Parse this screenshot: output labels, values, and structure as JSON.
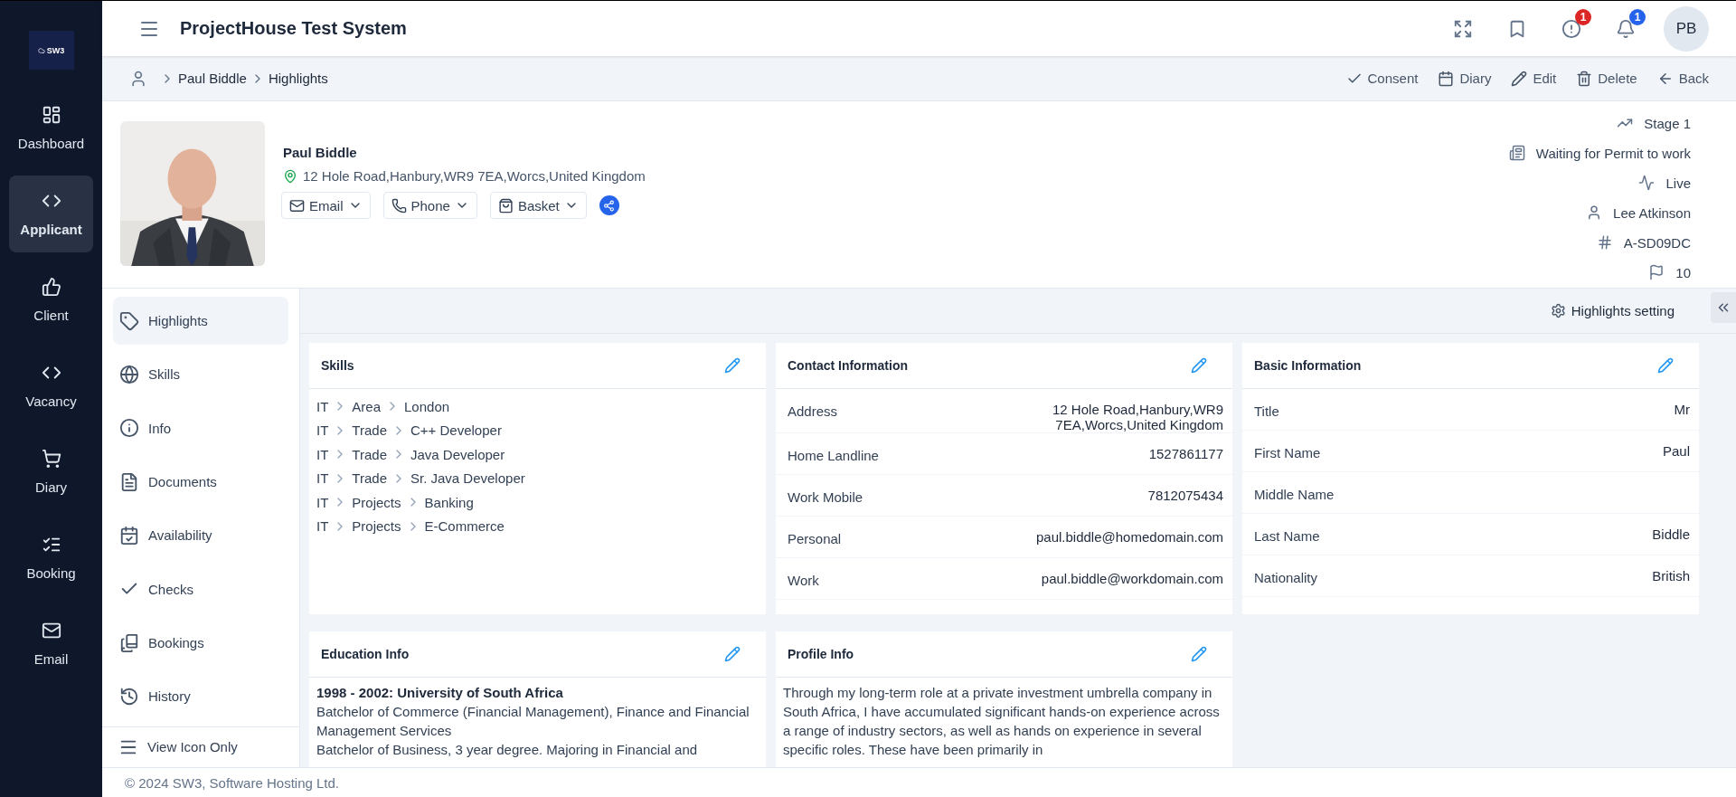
{
  "app": {
    "logo": "SW3",
    "title": "ProjectHouse Test System",
    "avatar": "PB"
  },
  "header_icons": [
    {
      "kind": "fullscreen"
    },
    {
      "kind": "bookmark"
    },
    {
      "kind": "alert",
      "badge": "1",
      "color": "#dc2626"
    },
    {
      "kind": "notifications",
      "badge": "1",
      "color": "#2563eb"
    }
  ],
  "nav": [
    {
      "label": "Dashboard",
      "selected": false
    },
    {
      "label": "Applicant",
      "selected": true
    },
    {
      "label": "Client",
      "selected": false
    },
    {
      "label": "Vacancy",
      "selected": false
    },
    {
      "label": "Diary",
      "selected": false
    },
    {
      "label": "Booking",
      "selected": false
    },
    {
      "label": "Email",
      "selected": false
    }
  ],
  "breadcrumb": [
    "Paul Biddle",
    "Highlights"
  ],
  "actions": [
    "Consent",
    "Diary",
    "Edit",
    "Delete",
    "Back"
  ],
  "profile": {
    "name": "Paul Biddle",
    "address": "12 Hole Road,Hanbury,WR9 7EA,Worcs,United Kingdom",
    "buttons": [
      "Email",
      "Phone",
      "Basket"
    ],
    "status": [
      "Stage 1",
      "Waiting for Permit to work",
      "Live",
      "Lee Atkinson",
      "A-SD09DC",
      "10"
    ]
  },
  "subnav": {
    "items": [
      {
        "label": "Highlights",
        "selected": true
      },
      {
        "label": "Skills",
        "selected": false
      },
      {
        "label": "Info",
        "selected": false
      },
      {
        "label": "Documents",
        "selected": false
      },
      {
        "label": "Availability",
        "selected": false
      },
      {
        "label": "Checks",
        "selected": false
      },
      {
        "label": "Bookings",
        "selected": false
      },
      {
        "label": "History",
        "selected": false
      }
    ],
    "toggle": "View Icon Only"
  },
  "settings_button": "Highlights setting",
  "cards": [
    {
      "kind": "paths",
      "title": "Skills",
      "paths": [
        [
          "IT",
          "Area",
          "London"
        ],
        [
          "IT",
          "Trade",
          "C++ Developer"
        ],
        [
          "IT",
          "Trade",
          "Java Developer"
        ],
        [
          "IT",
          "Trade",
          "Sr. Java Developer"
        ],
        [
          "IT",
          "Projects",
          "Banking"
        ],
        [
          "IT",
          "Projects",
          "E-Commerce"
        ]
      ]
    },
    {
      "kind": "fields",
      "title": "Contact Information",
      "rows": [
        {
          "label": "Address",
          "value": "12 Hole Road,Hanbury,WR9 7EA,Worcs,United Kingdom"
        },
        {
          "label": "Home Landline",
          "value": "1527861177"
        },
        {
          "label": "Work Mobile",
          "value": "7812075434"
        },
        {
          "label": "Personal",
          "value": "paul.biddle@homedomain.com"
        },
        {
          "label": "Work",
          "value": "paul.biddle@workdomain.com"
        }
      ]
    },
    {
      "kind": "fields",
      "title": "Basic Information",
      "rows": [
        {
          "label": "Title",
          "value": "Mr"
        },
        {
          "label": "First Name",
          "value": "Paul"
        },
        {
          "label": "Middle Name"
        },
        {
          "label": "Last Name",
          "value": "Biddle"
        },
        {
          "label": "Nationality",
          "value": "British"
        }
      ]
    },
    {
      "kind": "text",
      "title": "Education Info",
      "heading": "1998 - 2002: University of South Africa",
      "lines": [
        "Batchelor of Commerce (Financial Management), Finance and Financial Management Services",
        "Batchelor of Business, 3 year degree. Majoring in Financial and"
      ]
    },
    {
      "kind": "text",
      "title": "Profile Info",
      "lines": [
        "Through my long-term role at a private investment umbrella company in South Africa, I have accumulated significant hands-on experience across a range of industry sectors, as well as hands on experience in several specific roles. These have been primarily in"
      ]
    }
  ],
  "footer": "© 2024 SW3, Software Hosting Ltd."
}
